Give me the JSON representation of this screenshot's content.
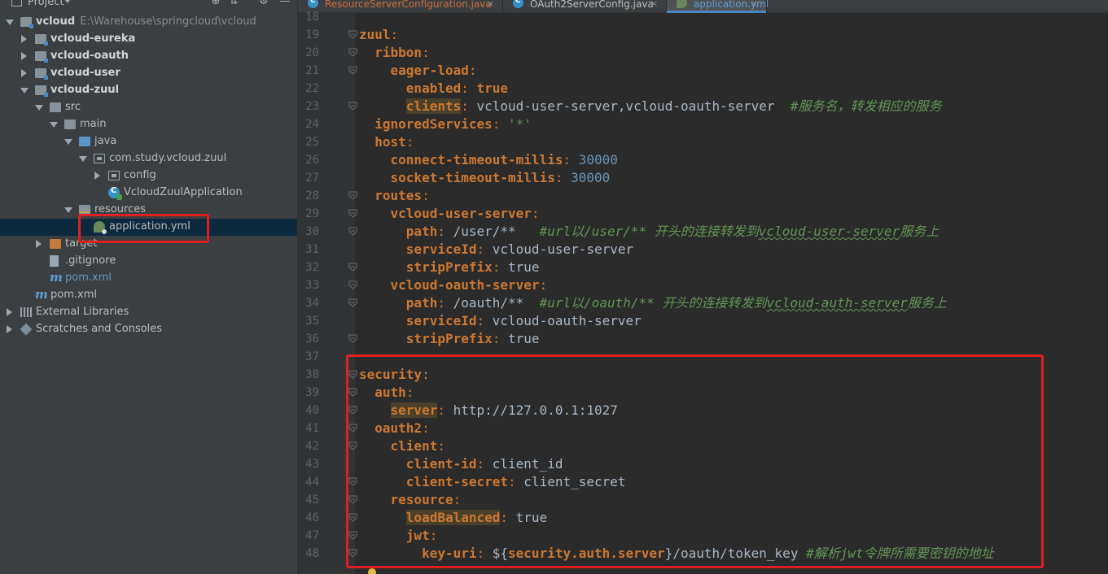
{
  "project_panel": {
    "title": "Project",
    "tree": [
      {
        "label": "vcloud",
        "path": "E:\\Warehouse\\springcloud\\vcloud",
        "level": 0,
        "expanded": true,
        "icon": "module-folder-icon",
        "bold": true
      },
      {
        "label": "vcloud-eureka",
        "level": 1,
        "expanded": false,
        "icon": "module-folder-icon",
        "bold": true
      },
      {
        "label": "vcloud-oauth",
        "level": 1,
        "expanded": false,
        "icon": "module-folder-icon",
        "bold": true
      },
      {
        "label": "vcloud-user",
        "level": 1,
        "expanded": false,
        "icon": "module-folder-icon",
        "bold": true
      },
      {
        "label": "vcloud-zuul",
        "level": 1,
        "expanded": true,
        "icon": "module-folder-icon",
        "bold": true
      },
      {
        "label": "src",
        "level": 2,
        "expanded": true,
        "icon": "folder-icon"
      },
      {
        "label": "main",
        "level": 3,
        "expanded": true,
        "icon": "folder-icon"
      },
      {
        "label": "java",
        "level": 4,
        "expanded": true,
        "icon": "source-folder-icon"
      },
      {
        "label": "com.study.vcloud.zuul",
        "level": 5,
        "expanded": true,
        "icon": "package-icon"
      },
      {
        "label": "config",
        "level": 6,
        "expanded": false,
        "icon": "package-icon"
      },
      {
        "label": "VcloudZuulApplication",
        "level": 6,
        "icon": "spring-class-icon"
      },
      {
        "label": "resources",
        "level": 4,
        "expanded": true,
        "icon": "resources-folder-icon"
      },
      {
        "label": "application.yml",
        "level": 5,
        "icon": "yaml-file-icon",
        "selected": true
      },
      {
        "label": "target",
        "level": 2,
        "expanded": false,
        "icon": "target-folder-icon"
      },
      {
        "label": ".gitignore",
        "level": 2,
        "icon": "text-file-icon"
      },
      {
        "label": "pom.xml",
        "level": 2,
        "icon": "maven-icon",
        "blue": true
      },
      {
        "label": "pom.xml",
        "level": 1,
        "icon": "maven-icon"
      },
      {
        "label": "External Libraries",
        "level": 0,
        "expanded": false,
        "icon": "libraries-icon"
      },
      {
        "label": "Scratches and Consoles",
        "level": 0,
        "expanded": false,
        "icon": "scratches-icon"
      }
    ]
  },
  "editor": {
    "tabs": [
      {
        "label": "ResourceServerConfiguration.java",
        "icon": "java-class-icon",
        "modified": true
      },
      {
        "label": "OAuth2ServerConfig.java",
        "icon": "java-class-icon"
      },
      {
        "label": "application.yml",
        "icon": "yaml-file-icon",
        "active": true
      }
    ],
    "first_line_number": 18,
    "lines": [
      [],
      [
        [
          "k",
          "zuul"
        ],
        [
          "p",
          ":"
        ]
      ],
      [
        [
          "t",
          "  "
        ],
        [
          "k",
          "ribbon"
        ],
        [
          "p",
          ":"
        ]
      ],
      [
        [
          "t",
          "    "
        ],
        [
          "k",
          "eager-load"
        ],
        [
          "p",
          ":"
        ]
      ],
      [
        [
          "t",
          "      "
        ],
        [
          "k",
          "enabled"
        ],
        [
          "p",
          ": "
        ],
        [
          "vb",
          "true"
        ]
      ],
      [
        [
          "t",
          "      "
        ],
        [
          "kh",
          "clients"
        ],
        [
          "p",
          ": "
        ],
        [
          "v",
          "vcloud-user-server,vcloud-oauth-server  "
        ],
        [
          "c",
          "#服务名，转发相应的服务"
        ]
      ],
      [
        [
          "t",
          "  "
        ],
        [
          "k",
          "ignoredServices"
        ],
        [
          "p",
          ": "
        ],
        [
          "s",
          "'*'"
        ]
      ],
      [
        [
          "t",
          "  "
        ],
        [
          "k",
          "host"
        ],
        [
          "p",
          ":"
        ]
      ],
      [
        [
          "t",
          "    "
        ],
        [
          "k",
          "connect-timeout-millis"
        ],
        [
          "p",
          ": "
        ],
        [
          "n",
          "30000"
        ]
      ],
      [
        [
          "t",
          "    "
        ],
        [
          "k",
          "socket-timeout-millis"
        ],
        [
          "p",
          ": "
        ],
        [
          "n",
          "30000"
        ]
      ],
      [
        [
          "t",
          "  "
        ],
        [
          "k",
          "routes"
        ],
        [
          "p",
          ":"
        ]
      ],
      [
        [
          "t",
          "    "
        ],
        [
          "k",
          "vcloud-user-server"
        ],
        [
          "p",
          ":"
        ]
      ],
      [
        [
          "t",
          "      "
        ],
        [
          "k",
          "path"
        ],
        [
          "p",
          ": "
        ],
        [
          "v",
          "/user/**   "
        ],
        [
          "c",
          "#url以/user/** 开头的连接转发到"
        ],
        [
          "cw",
          "vcloud-user-server"
        ],
        [
          "c",
          "服务上"
        ]
      ],
      [
        [
          "t",
          "      "
        ],
        [
          "k",
          "serviceId"
        ],
        [
          "p",
          ": "
        ],
        [
          "v",
          "vcloud-user-server"
        ]
      ],
      [
        [
          "t",
          "      "
        ],
        [
          "k",
          "stripPrefix"
        ],
        [
          "p",
          ": "
        ],
        [
          "v",
          "true"
        ]
      ],
      [
        [
          "t",
          "    "
        ],
        [
          "k",
          "vcloud-oauth-server"
        ],
        [
          "p",
          ":"
        ]
      ],
      [
        [
          "t",
          "      "
        ],
        [
          "k",
          "path"
        ],
        [
          "p",
          ": "
        ],
        [
          "v",
          "/oauth/**  "
        ],
        [
          "c",
          "#url以/oauth/** 开头的连接转发到"
        ],
        [
          "cw",
          "vcloud-auth-server"
        ],
        [
          "c",
          "服务上"
        ]
      ],
      [
        [
          "t",
          "      "
        ],
        [
          "k",
          "serviceId"
        ],
        [
          "p",
          ": "
        ],
        [
          "v",
          "vcloud-oauth-server"
        ]
      ],
      [
        [
          "t",
          "      "
        ],
        [
          "k",
          "stripPrefix"
        ],
        [
          "p",
          ": "
        ],
        [
          "v",
          "true"
        ]
      ],
      [],
      [
        [
          "k",
          "security"
        ],
        [
          "p",
          ":"
        ]
      ],
      [
        [
          "t",
          "  "
        ],
        [
          "k",
          "auth"
        ],
        [
          "p",
          ":"
        ]
      ],
      [
        [
          "t",
          "    "
        ],
        [
          "kh",
          "server"
        ],
        [
          "p",
          ": "
        ],
        [
          "v",
          "http://127.0.0.1:1027"
        ]
      ],
      [
        [
          "t",
          "  "
        ],
        [
          "k",
          "oauth2"
        ],
        [
          "p",
          ":"
        ]
      ],
      [
        [
          "t",
          "    "
        ],
        [
          "k",
          "client"
        ],
        [
          "p",
          ":"
        ]
      ],
      [
        [
          "t",
          "      "
        ],
        [
          "k",
          "client-id"
        ],
        [
          "p",
          ": "
        ],
        [
          "v",
          "client_id"
        ]
      ],
      [
        [
          "t",
          "      "
        ],
        [
          "k",
          "client-secret"
        ],
        [
          "p",
          ": "
        ],
        [
          "v",
          "client_secret"
        ]
      ],
      [
        [
          "t",
          "    "
        ],
        [
          "k",
          "resource"
        ],
        [
          "p",
          ":"
        ]
      ],
      [
        [
          "t",
          "      "
        ],
        [
          "kh",
          "loadBalanced"
        ],
        [
          "p",
          ": "
        ],
        [
          "v",
          "true"
        ]
      ],
      [
        [
          "t",
          "      "
        ],
        [
          "k",
          "jwt"
        ],
        [
          "p",
          ":"
        ]
      ],
      [
        [
          "t",
          "        "
        ],
        [
          "k",
          "key-uri"
        ],
        [
          "p",
          ": "
        ],
        [
          "v",
          "${"
        ],
        [
          "vb",
          "security.auth.server"
        ],
        [
          "v",
          "}/oauth/token_key "
        ],
        [
          "c",
          "#解析jwt令牌所需要密钥的地址"
        ]
      ]
    ]
  },
  "annotations": {
    "highlight_color": "#e02020"
  }
}
